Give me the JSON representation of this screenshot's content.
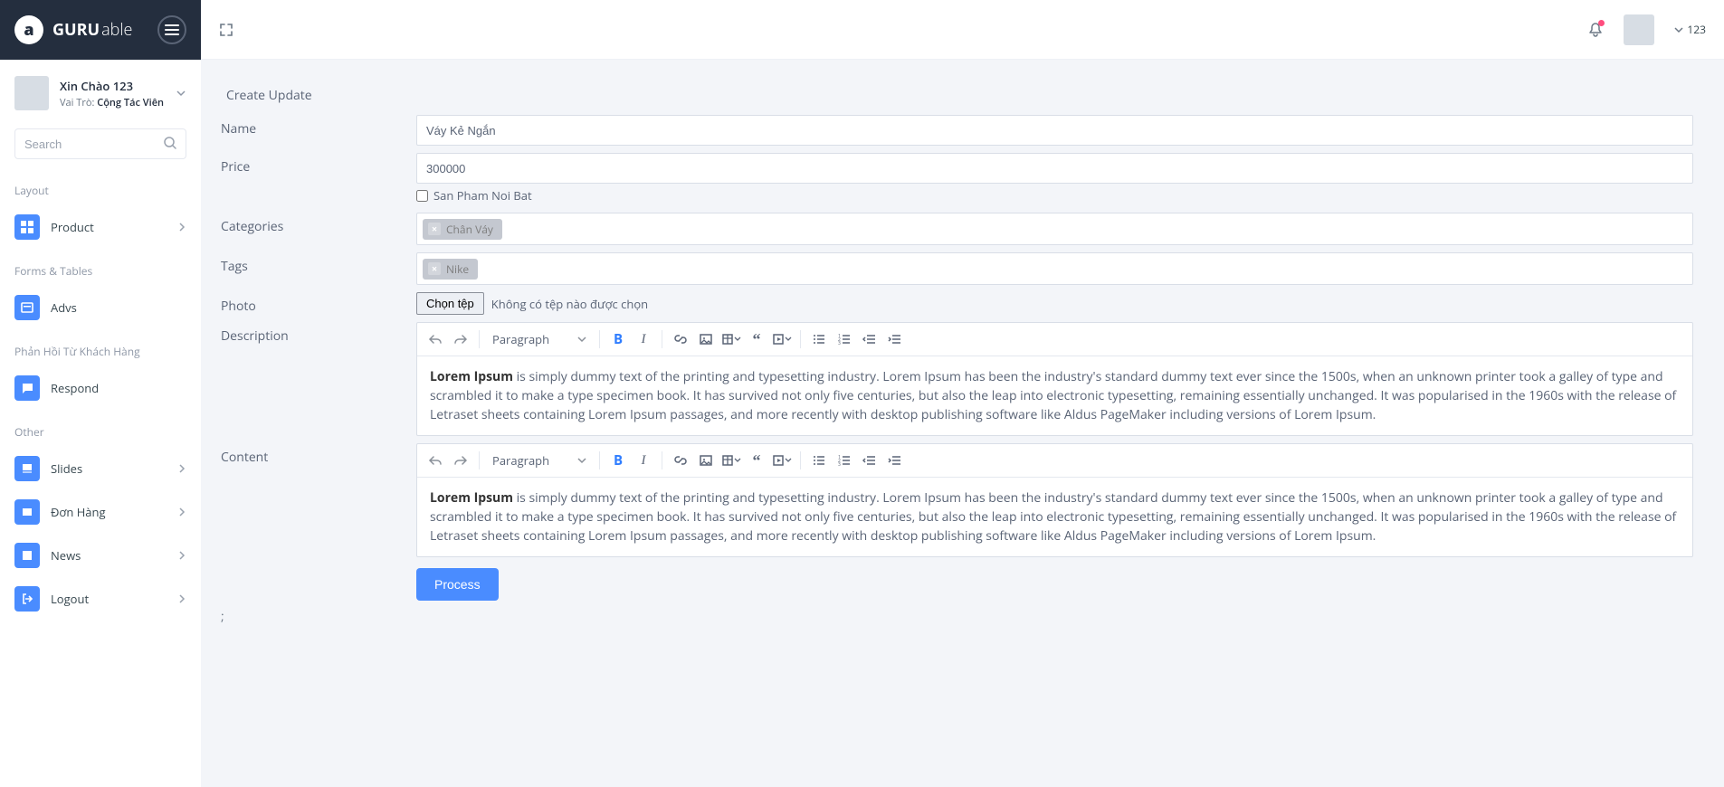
{
  "brand": {
    "name1": "GURU",
    "name2": "able"
  },
  "user": {
    "greeting": "Xin Chào 123",
    "role_label": "Vai Trò:",
    "role_value": "Cộng Tác Viên"
  },
  "search": {
    "placeholder": "Search"
  },
  "nav": {
    "group_layout": "Layout",
    "group_forms": "Forms & Tables",
    "group_feedback": "Phản Hồi Từ Khách Hàng",
    "group_other": "Other",
    "product": "Product",
    "advs": "Advs",
    "respond": "Respond",
    "slides": "Slides",
    "orders": "Đơn Hàng",
    "news": "News",
    "logout": "Logout"
  },
  "topbar": {
    "username": "123"
  },
  "page": {
    "title": "Create Update"
  },
  "form": {
    "labels": {
      "name": "Name",
      "price": "Price",
      "featured": "San Pham Noi Bat",
      "categories": "Categories",
      "tags": "Tags",
      "photo": "Photo",
      "description": "Description",
      "content": "Content"
    },
    "values": {
      "name": "Váy Kẻ Ngắn",
      "price": "300000",
      "category_tag": "Chân Váy",
      "tag_tag": "Nike",
      "file_button": "Chọn tệp",
      "file_status": "Không có tệp nào được chọn"
    },
    "editor": {
      "format_label": "Paragraph",
      "desc_bold": "Lorem Ipsum",
      "desc_rest": " is simply dummy text of the printing and typesetting industry. Lorem Ipsum has been the industry's standard dummy text ever since the 1500s, when an unknown printer took a galley of type and scrambled it to make a type specimen book. It has survived not only five centuries, but also the leap into electronic typesetting, remaining essentially unchanged. It was popularised in the 1960s with the release of Letraset sheets containing Lorem Ipsum passages, and more recently with desktop publishing software like Aldus PageMaker including versions of Lorem Ipsum.",
      "content_bold": "Lorem Ipsum",
      "content_rest": " is simply dummy text of the printing and typesetting industry. Lorem Ipsum has been the industry's standard dummy text ever since the 1500s, when an unknown printer took a galley of type and scrambled it to make a type specimen book. It has survived not only five centuries, but also the leap into electronic typesetting, remaining essentially unchanged. It was popularised in the 1960s with the release of Letraset sheets containing Lorem Ipsum passages, and more recently with desktop publishing software like Aldus PageMaker including versions of Lorem Ipsum."
    },
    "submit": "Process"
  }
}
